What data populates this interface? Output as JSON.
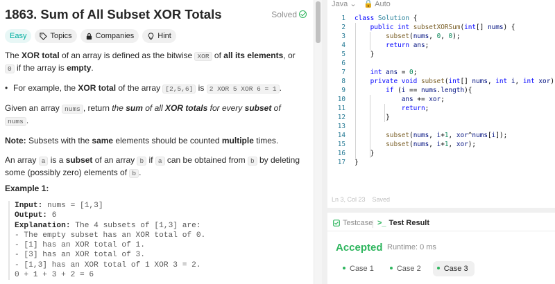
{
  "problem": {
    "title": "1863. Sum of All Subset XOR Totals",
    "solved_label": "Solved",
    "tags": {
      "difficulty": "Easy",
      "topics": "Topics",
      "companies": "Companies",
      "hint": "Hint"
    },
    "desc": {
      "p1_a": "The ",
      "p1_b": "XOR total",
      "p1_c": " of an array is defined as the bitwise ",
      "p1_code1": "XOR",
      "p1_d": " of ",
      "p1_e": "all its elements",
      "p1_f": ", or ",
      "p1_code2": "0",
      "p1_g": " if the array is ",
      "p1_h": "empty",
      "p1_i": ".",
      "b1_a": "For example, the ",
      "b1_b": "XOR total",
      "b1_c": " of the array ",
      "b1_code1": "[2,5,6]",
      "b1_d": " is ",
      "b1_code2": "2 XOR 5 XOR 6 = 1",
      "b1_e": ".",
      "p2_a": "Given an array ",
      "p2_code1": "nums",
      "p2_b": ", return ",
      "p2_c": "the ",
      "p2_d": "sum",
      "p2_e": " of all ",
      "p2_f": "XOR totals",
      "p2_g": " for every ",
      "p2_h": "subset",
      "p2_i": " of ",
      "p2_code2": "nums",
      "p2_j": ".",
      "note_a": "Note:",
      "note_b": " Subsets with the ",
      "note_c": "same",
      "note_d": " elements should be counted ",
      "note_e": "multiple",
      "note_f": " times.",
      "p3_a": "An array ",
      "p3_code1": "a",
      "p3_b": " is a ",
      "p3_c": "subset",
      "p3_d": " of an array ",
      "p3_code2": "b",
      "p3_e": " if ",
      "p3_code3": "a",
      "p3_f": " can be obtained from ",
      "p3_code4": "b",
      "p3_g": " by deleting some (possibly zero) elements of ",
      "p3_code5": "b",
      "p3_h": "."
    },
    "example": {
      "title": "Example 1:",
      "input_label": "Input:",
      "input_value": " nums = [1,3]",
      "output_label": "Output:",
      "output_value": " 6",
      "explanation_label": "Explanation:",
      "explanation_value": " The 4 subsets of [1,3] are:",
      "lines": [
        "- The empty subset has an XOR total of 0.",
        "- [1] has an XOR total of 1.",
        "- [3] has an XOR total of 3.",
        "- [1,3] has an XOR total of 1 XOR 3 = 2.",
        "0 + 1 + 3 + 2 = 6"
      ]
    }
  },
  "editor": {
    "language": "Java",
    "mode": "Auto",
    "status_pos": "Ln 3, Col 23",
    "status_saved": "Saved",
    "line_numbers": [
      "1",
      "2",
      "3",
      "4",
      "5",
      "6",
      "7",
      "8",
      "9",
      "10",
      "11",
      "12",
      "13",
      "14",
      "15",
      "16",
      "17"
    ]
  },
  "result": {
    "tab_testcase": "Testcase",
    "tab_result": "Test Result",
    "status": "Accepted",
    "runtime": "Runtime: 0 ms",
    "cases": [
      "Case 1",
      "Case 2",
      "Case 3"
    ]
  },
  "colors": {
    "accent_green": "#2db55d",
    "easy": "#00afa0"
  }
}
